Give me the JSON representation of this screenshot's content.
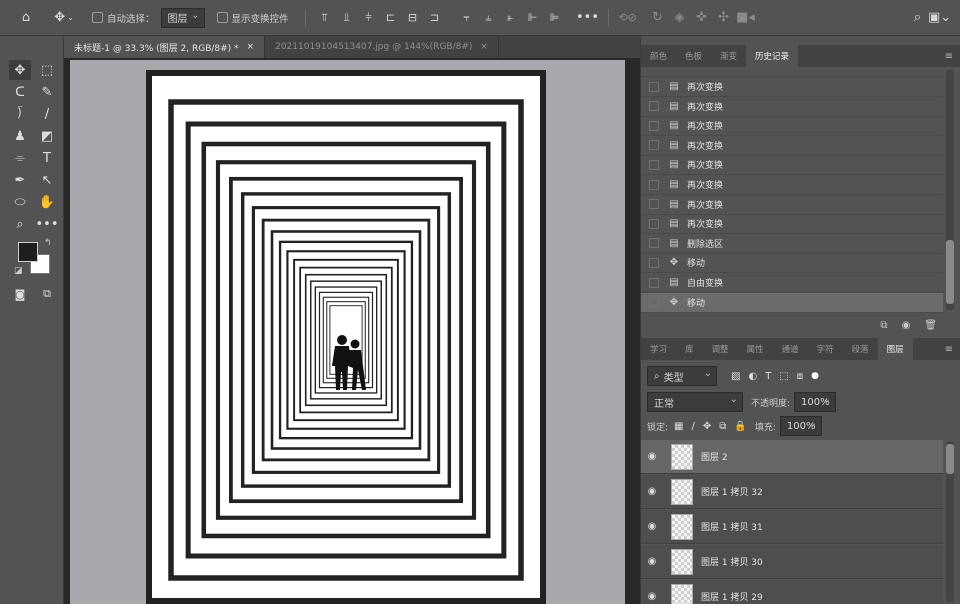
{
  "options_bar": {
    "auto_select_label": "自动选择：",
    "auto_select_value": "图层",
    "show_transform_label": "显示变换控件"
  },
  "doc_tabs": [
    {
      "label": "未标题-1 @ 33.3% (图层 2, RGB/8#) *",
      "close": "×"
    },
    {
      "label": "20211019104513407.jpg @ 144%(RGB/8#)",
      "close": "×"
    }
  ],
  "top_panel_tabs": [
    "颜色",
    "色板",
    "渐变",
    "历史记录"
  ],
  "history": {
    "items": [
      {
        "label": "再次变换",
        "icon": "doc-icon"
      },
      {
        "label": "再次变换",
        "icon": "doc-icon"
      },
      {
        "label": "再次变换",
        "icon": "doc-icon"
      },
      {
        "label": "再次变换",
        "icon": "doc-icon"
      },
      {
        "label": "再次变换",
        "icon": "doc-icon"
      },
      {
        "label": "再次变换",
        "icon": "doc-icon"
      },
      {
        "label": "再次变换",
        "icon": "doc-icon"
      },
      {
        "label": "再次变换",
        "icon": "doc-icon"
      },
      {
        "label": "删除选区",
        "icon": "doc-icon"
      },
      {
        "label": "移动",
        "icon": "move-icon"
      },
      {
        "label": "自由变换",
        "icon": "doc-icon"
      },
      {
        "label": "移动",
        "icon": "move-icon"
      }
    ]
  },
  "bottom_panel_tabs": [
    "学习",
    "库",
    "调整",
    "属性",
    "通道",
    "字符",
    "段落",
    "图层"
  ],
  "layers_panel": {
    "filter_kind": "类型",
    "blend_mode": "正常",
    "opacity_label": "不透明度:",
    "opacity_value": "100%",
    "lock_label": "锁定:",
    "fill_label": "填充:",
    "fill_value": "100%",
    "layers": [
      {
        "name": "图层 2",
        "selected": true
      },
      {
        "name": "图层 1 拷贝 32",
        "selected": false
      },
      {
        "name": "图层 1 拷贝 31",
        "selected": false
      },
      {
        "name": "图层 1 拷贝 30",
        "selected": false
      },
      {
        "name": "图层 1 拷贝 29",
        "selected": false
      }
    ]
  },
  "colors": {
    "bg": "#535353",
    "panel_dark": "#424242",
    "pasteboard": "#a9a9ad",
    "artwork_line": "#222222"
  }
}
